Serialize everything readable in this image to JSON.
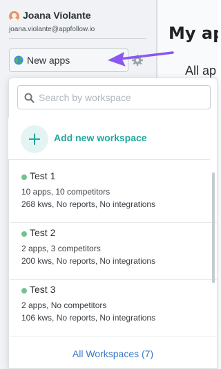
{
  "user": {
    "name": "Joana Violante",
    "email": "joana.violante@appfollow.io"
  },
  "workspace_selector": {
    "label": "New apps",
    "globe_icon": "globe-icon",
    "settings_icon": "gear-icon"
  },
  "main": {
    "title": "My ap",
    "subtitle": "All ap"
  },
  "dropdown": {
    "search": {
      "placeholder": "Search by workspace",
      "value": ""
    },
    "add_workspace_label": "Add new workspace",
    "workspaces": [
      {
        "name": "Test 1",
        "line1": "10 apps, 10 competitors",
        "line2": "268 kws, No reports, No integrations"
      },
      {
        "name": "Test 2",
        "line1": "2 apps, 3 competitors",
        "line2": "200 kws, No reports, No integrations"
      },
      {
        "name": "Test 3",
        "line1": "2 apps, No competitors",
        "line2": "106 kws, No reports, No integrations"
      }
    ],
    "all_workspaces_label": "All Workspaces (7)"
  },
  "colors": {
    "accent_teal": "#21a79c",
    "status_dot": "#71c48f",
    "link_blue": "#3a78c4",
    "arrow_purple": "#8a57f2"
  }
}
